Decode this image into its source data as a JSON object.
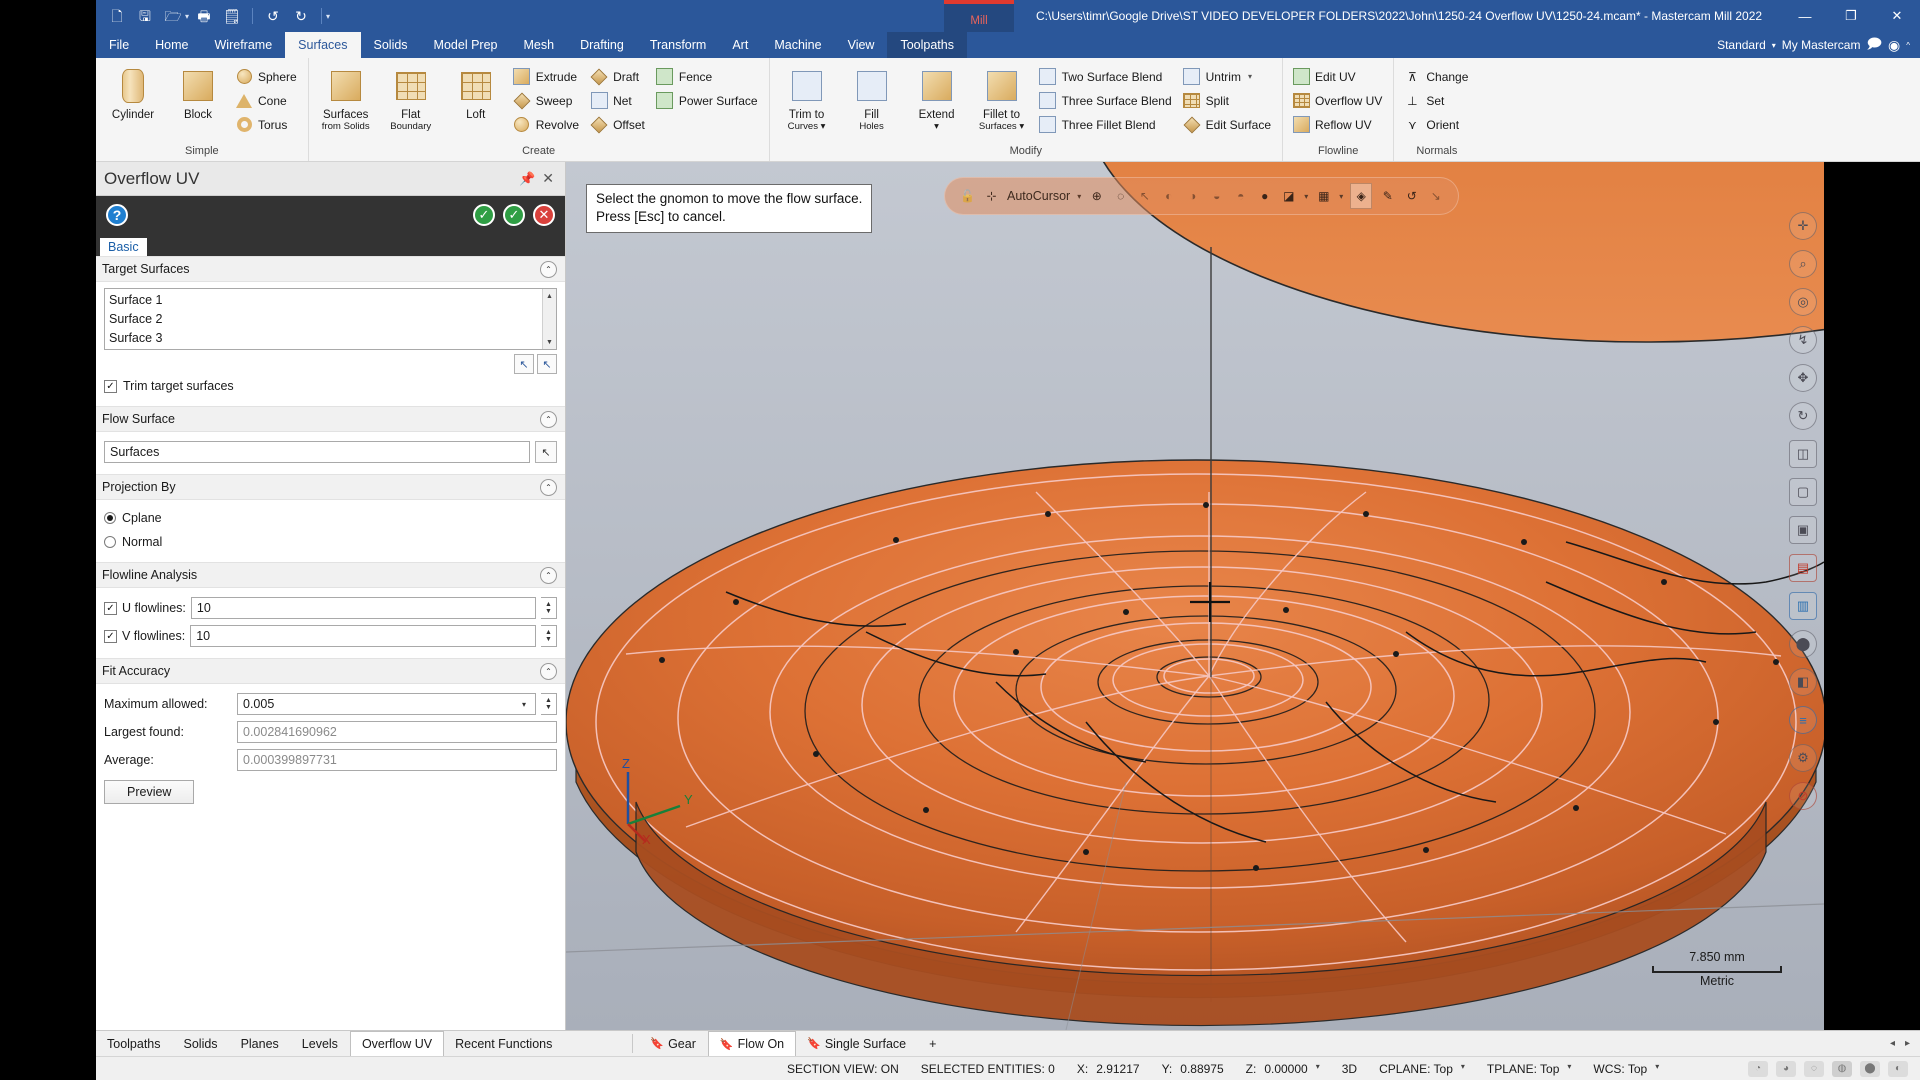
{
  "titlebar": {
    "quick_access": [
      {
        "name": "new-file-icon",
        "glyph": "🗋"
      },
      {
        "name": "save-icon",
        "glyph": "🖫"
      },
      {
        "name": "open-folder-icon",
        "glyph": "🗀"
      },
      {
        "name": "print-icon",
        "glyph": "🖶"
      },
      {
        "name": "print-preview-icon",
        "glyph": "🖷"
      },
      {
        "name": "undo-icon",
        "glyph": "↺"
      },
      {
        "name": "redo-icon",
        "glyph": "↻"
      },
      {
        "name": "customize-qat-icon",
        "glyph": "▾"
      }
    ],
    "machine_tag": "Mill",
    "document_path": "C:\\Users\\timr\\Google Drive\\ST VIDEO DEVELOPER FOLDERS\\2022\\John\\1250-24 Overflow UV\\1250-24.mcam* - Mastercam Mill 2022",
    "minimize": "—",
    "restore": "❐",
    "close": "✕"
  },
  "ribbon": {
    "tabs": [
      {
        "label": "File",
        "active": false
      },
      {
        "label": "Home",
        "active": false
      },
      {
        "label": "Wireframe",
        "active": false
      },
      {
        "label": "Surfaces",
        "active": true
      },
      {
        "label": "Solids",
        "active": false
      },
      {
        "label": "Model Prep",
        "active": false
      },
      {
        "label": "Mesh",
        "active": false
      },
      {
        "label": "Drafting",
        "active": false
      },
      {
        "label": "Transform",
        "active": false
      },
      {
        "label": "Art",
        "active": false
      },
      {
        "label": "Machine",
        "active": false
      },
      {
        "label": "View",
        "active": false
      },
      {
        "label": "Toolpaths",
        "active": false
      }
    ],
    "right": {
      "config": "Standard",
      "account": "My Mastercam",
      "chat_icon": "🗩",
      "help_icon": "?",
      "collapse_icon": "^"
    },
    "groups": [
      {
        "label": "Simple",
        "big": [
          {
            "label": "Cylinder",
            "icon": "cylinder-icon"
          },
          {
            "label": "Block",
            "icon": "block-icon"
          }
        ],
        "small": [
          {
            "label": "Sphere",
            "icon": "sphere-icon"
          },
          {
            "label": "Cone",
            "icon": "cone-icon"
          },
          {
            "label": "Torus",
            "icon": "torus-icon"
          }
        ]
      },
      {
        "label": "Create",
        "big": [
          {
            "label": "Surfaces",
            "label2": "from Solids",
            "icon": "surfaces-from-solids-icon"
          },
          {
            "label": "Flat",
            "label2": "Boundary",
            "icon": "flat-boundary-icon"
          },
          {
            "label": "Loft",
            "label2": "",
            "icon": "loft-icon"
          }
        ],
        "small_a": [
          {
            "label": "Extrude",
            "icon": "extrude-icon"
          },
          {
            "label": "Sweep",
            "icon": "sweep-icon"
          },
          {
            "label": "Revolve",
            "icon": "revolve-icon"
          }
        ],
        "small_b": [
          {
            "label": "Draft",
            "icon": "draft-icon"
          },
          {
            "label": "Net",
            "icon": "net-icon"
          },
          {
            "label": "Offset",
            "icon": "offset-icon"
          }
        ],
        "small_c": [
          {
            "label": "Fence",
            "icon": "fence-icon"
          },
          {
            "label": "Power Surface",
            "icon": "power-surface-icon"
          }
        ]
      },
      {
        "label": "Modify",
        "big": [
          {
            "label": "Trim to",
            "label2": "Curves ▾",
            "icon": "trim-to-curves-icon"
          },
          {
            "label": "Fill",
            "label2": "Holes",
            "icon": "fill-holes-icon"
          },
          {
            "label": "Extend",
            "label2": "▾",
            "icon": "extend-icon"
          },
          {
            "label": "Fillet to",
            "label2": "Surfaces ▾",
            "icon": "fillet-to-surfaces-icon"
          }
        ],
        "small_a": [
          {
            "label": "Two Surface Blend",
            "icon": "two-surface-blend-icon"
          },
          {
            "label": "Three Surface Blend",
            "icon": "three-surface-blend-icon"
          },
          {
            "label": "Three Fillet Blend",
            "icon": "three-fillet-blend-icon"
          }
        ],
        "small_b": [
          {
            "label": "Untrim",
            "icon": "untrim-icon",
            "caret": true
          },
          {
            "label": "Split",
            "icon": "split-icon"
          },
          {
            "label": "Edit Surface",
            "icon": "edit-surface-icon"
          }
        ]
      },
      {
        "label": "Flowline",
        "small_a": [
          {
            "label": "Edit UV",
            "icon": "edit-uv-icon"
          },
          {
            "label": "Overflow UV",
            "icon": "overflow-uv-icon"
          },
          {
            "label": "Reflow UV",
            "icon": "reflow-uv-icon"
          }
        ]
      },
      {
        "label": "Normals",
        "small_a": [
          {
            "label": "Change",
            "icon": "change-normals-icon"
          },
          {
            "label": "Set",
            "icon": "set-normals-icon"
          },
          {
            "label": "Orient",
            "icon": "orient-normals-icon"
          }
        ]
      }
    ]
  },
  "panel": {
    "title": "Overflow UV",
    "pin_icon": "📌",
    "close_icon": "✕",
    "help_icon": "?",
    "apply_icon": "✓",
    "ok_icon": "✓",
    "cancel_icon": "✕",
    "tab": "Basic",
    "target_surfaces": {
      "header": "Target Surfaces",
      "items": [
        "Surface 1",
        "Surface 2",
        "Surface 3"
      ],
      "select_icon": "↖",
      "deselect_icon": "↖"
    },
    "trim_checkbox": {
      "label": "Trim target surfaces",
      "checked": true,
      "mark": "✓"
    },
    "flow_surface": {
      "header": "Flow Surface",
      "value": "Surfaces",
      "pick_icon": "↖"
    },
    "projection_by": {
      "header": "Projection By",
      "options": [
        {
          "label": "Cplane",
          "selected": true
        },
        {
          "label": "Normal",
          "selected": false
        }
      ]
    },
    "flowline_analysis": {
      "header": "Flowline Analysis",
      "u_label": "U flowlines:",
      "u_value": "10",
      "u_checked": true,
      "v_label": "V flowlines:",
      "v_value": "10",
      "v_checked": true
    },
    "fit_accuracy": {
      "header": "Fit Accuracy",
      "max_label": "Maximum allowed:",
      "max_value": "0.005",
      "largest_label": "Largest found:",
      "largest_value": "0.002841690962",
      "average_label": "Average:",
      "average_value": "0.000399897731",
      "preview_button": "Preview"
    },
    "collapse_chevron": "⌃"
  },
  "viewport": {
    "tooltip_line1": "Select the gnomon to move the flow surface.",
    "tooltip_line2": "Press [Esc] to cancel.",
    "autocursor": {
      "label": "AutoCursor",
      "icons": [
        "lock-icon",
        "autocursor-icon",
        "origin-icon",
        "center-icon",
        "endpoint-icon",
        "midpoint-icon",
        "intersection-icon",
        "quadrant-icon",
        "point-icon",
        "along-icon",
        "nearest-icon",
        "grid-icon",
        "relative-icon",
        "sketch-icon",
        "rotate-icon",
        "arrow-icon"
      ]
    },
    "vertical_toolbar": [
      "fit-icon",
      "zoom-window-icon",
      "zoom-target-icon",
      "unzoom-icon",
      "pan-icon",
      "dynamic-rotate-icon",
      "isometric-icon",
      "top-view-icon",
      "front-view-icon",
      "right-view-icon",
      "wireframe-icon",
      "shaded-icon",
      "section-view-icon",
      "layers-icon",
      "settings-icon",
      "no-entry-icon"
    ],
    "gnomon": {
      "x": "X",
      "y": "Y",
      "z": "Z"
    },
    "scale": {
      "value": "7.850 mm",
      "units": "Metric"
    }
  },
  "bottom_tabs": {
    "left": [
      {
        "label": "Toolpaths",
        "active": false
      },
      {
        "label": "Solids",
        "active": false
      },
      {
        "label": "Planes",
        "active": false
      },
      {
        "label": "Levels",
        "active": false
      },
      {
        "label": "Overflow UV",
        "active": true
      },
      {
        "label": "Recent Functions",
        "active": false
      }
    ],
    "right": [
      {
        "label": "Gear",
        "active": false,
        "mark": "🔖"
      },
      {
        "label": "Flow On",
        "active": true,
        "mark": "🔖"
      },
      {
        "label": "Single Surface",
        "active": false,
        "mark": "🔖"
      }
    ],
    "add": "+",
    "nav_prev": "◂",
    "nav_next": "▸"
  },
  "statusbar": {
    "section_view": "SECTION VIEW: ON",
    "selected_entities": "SELECTED ENTITIES: 0",
    "x_label": "X:",
    "x_value": "2.91217",
    "y_label": "Y:",
    "y_value": "0.88975",
    "z_label": "Z:",
    "z_value": "0.00000",
    "mode": "3D",
    "cplane": "CPLANE: Top",
    "tplane": "TPLANE: Top",
    "wcs": "WCS: Top",
    "caret": "▾",
    "icons": [
      "shade-flat-icon",
      "shade-gouraud-icon",
      "wireframe-icon",
      "shaded-solid-icon",
      "shaded-ball-icon",
      "half-shaded-icon"
    ]
  }
}
